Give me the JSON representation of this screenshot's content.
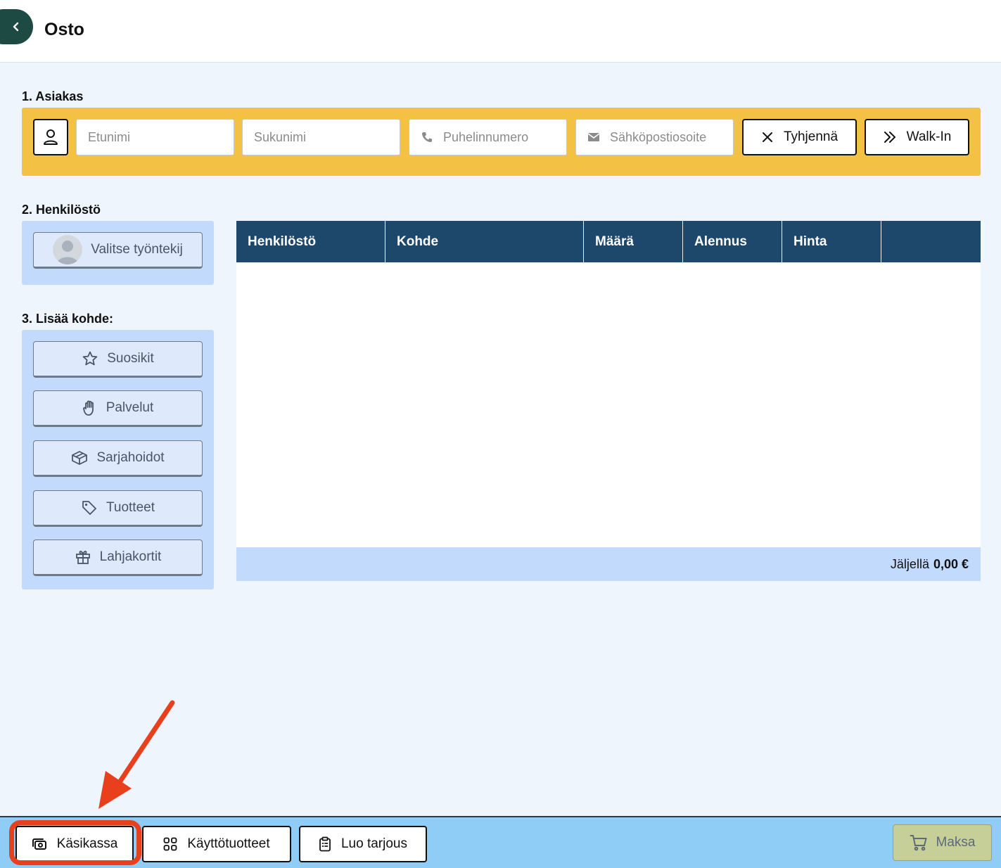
{
  "header": {
    "title": "Osto"
  },
  "customer": {
    "section_label": "1. Asiakas",
    "first_name_placeholder": "Etunimi",
    "last_name_placeholder": "Sukunimi",
    "phone_placeholder": "Puhelinnumero",
    "email_placeholder": "Sähköpostiosoite",
    "clear_label": "Tyhjennä",
    "walkin_label": "Walk-In"
  },
  "staff": {
    "section_label": "2. Henkilöstö",
    "select_employee_label": "Valitse työntekij"
  },
  "add_item": {
    "section_label": "3. Lisää kohde:",
    "buttons": [
      {
        "label": "Suosikit",
        "icon": "star-icon"
      },
      {
        "label": "Palvelut",
        "icon": "hand-icon"
      },
      {
        "label": "Sarjahoidot",
        "icon": "package-icon"
      },
      {
        "label": "Tuotteet",
        "icon": "tag-icon"
      },
      {
        "label": "Lahjakortit",
        "icon": "gift-icon"
      }
    ]
  },
  "table": {
    "columns": [
      "Henkilöstö",
      "Kohde",
      "Määrä",
      "Alennus",
      "Hinta",
      ""
    ],
    "rows": [],
    "footer_label": "Jäljellä",
    "footer_amount": "0,00 €"
  },
  "bottom": {
    "cash_register_label": "Käsikassa",
    "supplies_label": "Käyttötuotteet",
    "offer_label": "Luo tarjous",
    "pay_label": "Maksa"
  },
  "colors": {
    "customer_bar": "#f3c143",
    "table_header": "#1e486b",
    "highlight": "#e8401c",
    "pay_button": "#c6cf98",
    "bottom_bar": "#8fcdf7"
  }
}
